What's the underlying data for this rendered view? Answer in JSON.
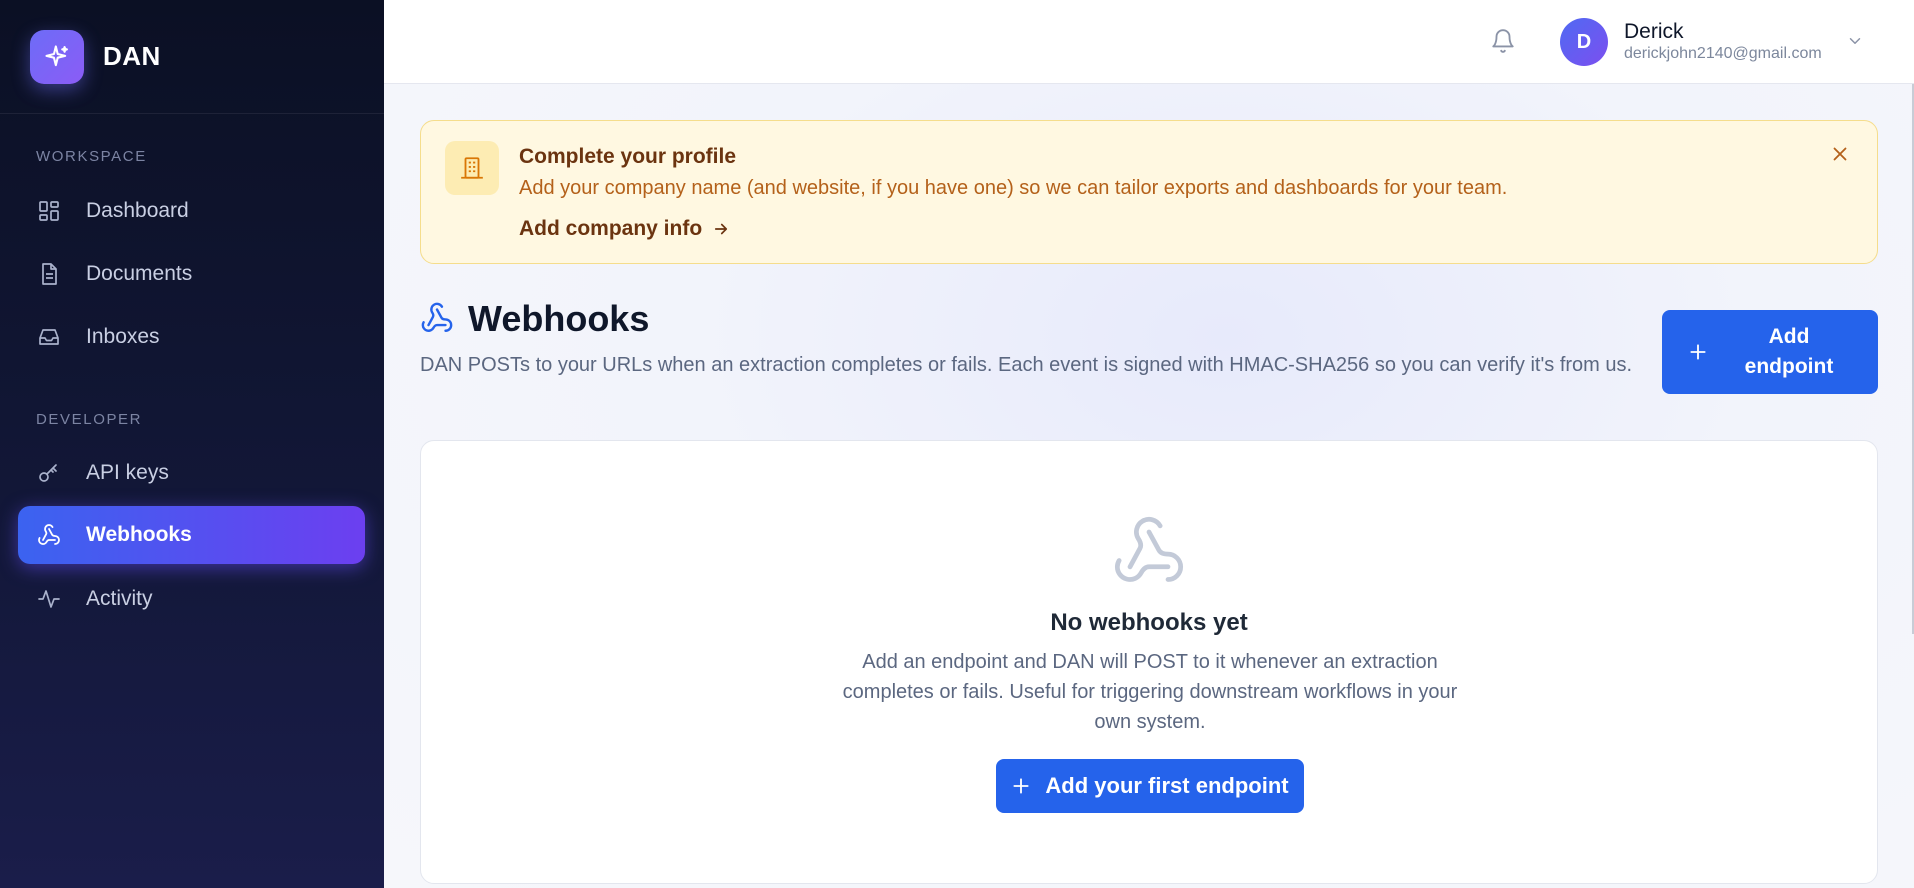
{
  "brand": {
    "name": "DAN"
  },
  "sidebar": {
    "sections": [
      {
        "label": "WORKSPACE"
      },
      {
        "label": "DEVELOPER"
      }
    ],
    "items": [
      {
        "label": "Dashboard",
        "icon": "dashboard-icon"
      },
      {
        "label": "Documents",
        "icon": "document-icon"
      },
      {
        "label": "Inboxes",
        "icon": "inbox-icon"
      },
      {
        "label": "API keys",
        "icon": "key-icon"
      },
      {
        "label": "Webhooks",
        "icon": "webhook-icon",
        "active": true
      },
      {
        "label": "Activity",
        "icon": "activity-icon"
      }
    ]
  },
  "header": {
    "user": {
      "initial": "D",
      "name": "Derick",
      "email": "derickjohn2140@gmail.com"
    }
  },
  "banner": {
    "title": "Complete your profile",
    "text": "Add your company name (and website, if you have one) so we can tailor exports and dashboards for your team.",
    "link": "Add company info"
  },
  "page": {
    "title": "Webhooks",
    "description": "DAN POSTs to your URLs when an extraction completes or fails. Each event is signed with HMAC-SHA256 so you can verify it's from us.",
    "add_button": "Add endpoint"
  },
  "empty_state": {
    "title": "No webhooks yet",
    "text": "Add an endpoint and DAN will POST to it whenever an extraction completes or fails. Useful for triggering downstream workflows in your own system.",
    "button": "Add your first endpoint"
  },
  "colors": {
    "primary": "#2563eb",
    "sidebar": "#0b1024",
    "active_gradient_start": "#3b63f0",
    "active_gradient_end": "#6c3ff0",
    "banner_bg": "#fff8e1"
  }
}
